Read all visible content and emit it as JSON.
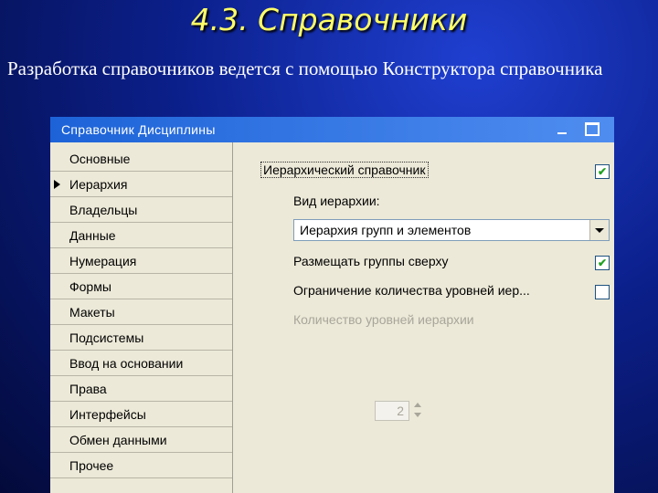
{
  "slide": {
    "title": "4.3. Справочники",
    "text": "Разработка справочников ведется с помощью Конструктора справочника"
  },
  "window": {
    "title": "Справочник Дисциплины",
    "minimize_icon": "minimize-icon",
    "maximize_icon": "maximize-icon"
  },
  "nav": {
    "items": [
      {
        "label": "Основные"
      },
      {
        "label": "Иерархия",
        "selected": true
      },
      {
        "label": "Владельцы"
      },
      {
        "label": "Данные"
      },
      {
        "label": "Нумерация"
      },
      {
        "label": "Формы"
      },
      {
        "label": "Макеты"
      },
      {
        "label": "Подсистемы"
      },
      {
        "label": "Ввод на основании"
      },
      {
        "label": "Права"
      },
      {
        "label": "Интерфейсы"
      },
      {
        "label": "Обмен данными"
      },
      {
        "label": "Прочее"
      }
    ]
  },
  "hierarchy": {
    "hierarchical_label": "Иерархический справочник",
    "hierarchical_checked": true,
    "type_label": "Вид иерархии:",
    "type_value": "Иерархия групп и элементов",
    "groups_top_label": "Размещать группы сверху",
    "groups_top_checked": true,
    "limit_label": "Ограничение количества уровней иер...",
    "limit_checked": false,
    "levels_label": "Количество уровней иерархии",
    "levels_value": "2",
    "check_mark": "✔"
  },
  "colors": {
    "title": "#ffff66",
    "titlebar": "#1d63d8",
    "panel": "#ece9d8"
  }
}
